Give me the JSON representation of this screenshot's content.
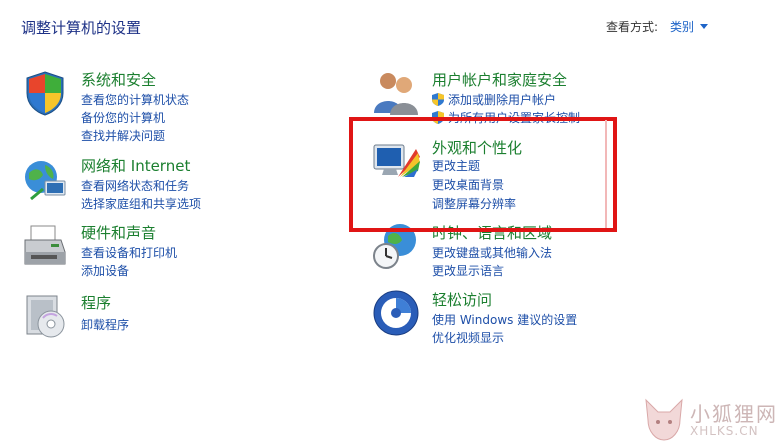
{
  "header": {
    "title": "调整计算机的设置",
    "view_by_label": "查看方式:",
    "view_mode": "类别"
  },
  "categories": [
    {
      "icon": "shield-flag-icon",
      "title": "系统和安全",
      "links": [
        "查看您的计算机状态",
        "备份您的计算机",
        "查找并解决问题"
      ]
    },
    {
      "icon": "network-globe-icon",
      "title": "网络和 Internet",
      "links": [
        "查看网络状态和任务",
        "选择家庭组和共享选项"
      ]
    },
    {
      "icon": "printer-icon",
      "title": "硬件和声音",
      "links": [
        "查看设备和打印机",
        "添加设备"
      ]
    },
    {
      "icon": "program-disc-icon",
      "title": "程序",
      "links": [
        "卸载程序"
      ]
    },
    {
      "icon": "users-icon",
      "title": "用户帐户和家庭安全",
      "links": [
        "添加或删除用户帐户",
        "为所有用户设置家长控制"
      ]
    },
    {
      "icon": "monitor-palette-icon",
      "title": "外观和个性化",
      "links": [
        "更改主题",
        "更改桌面背景",
        "调整屏幕分辨率"
      ]
    },
    {
      "icon": "clock-globe-icon",
      "title": "时钟、语言和区域",
      "links": [
        "更改键盘或其他输入法",
        "更改显示语言"
      ]
    },
    {
      "icon": "ease-of-access-icon",
      "title": "轻松访问",
      "links": [
        "使用 Windows 建议的设置",
        "优化视频显示"
      ]
    }
  ],
  "watermark": {
    "cn": "小狐狸网",
    "en": "XHLKS.CN"
  },
  "colors": {
    "title_green": "#1b7f2f",
    "link_blue": "#1e4fa8",
    "highlight_red": "#e01515"
  }
}
